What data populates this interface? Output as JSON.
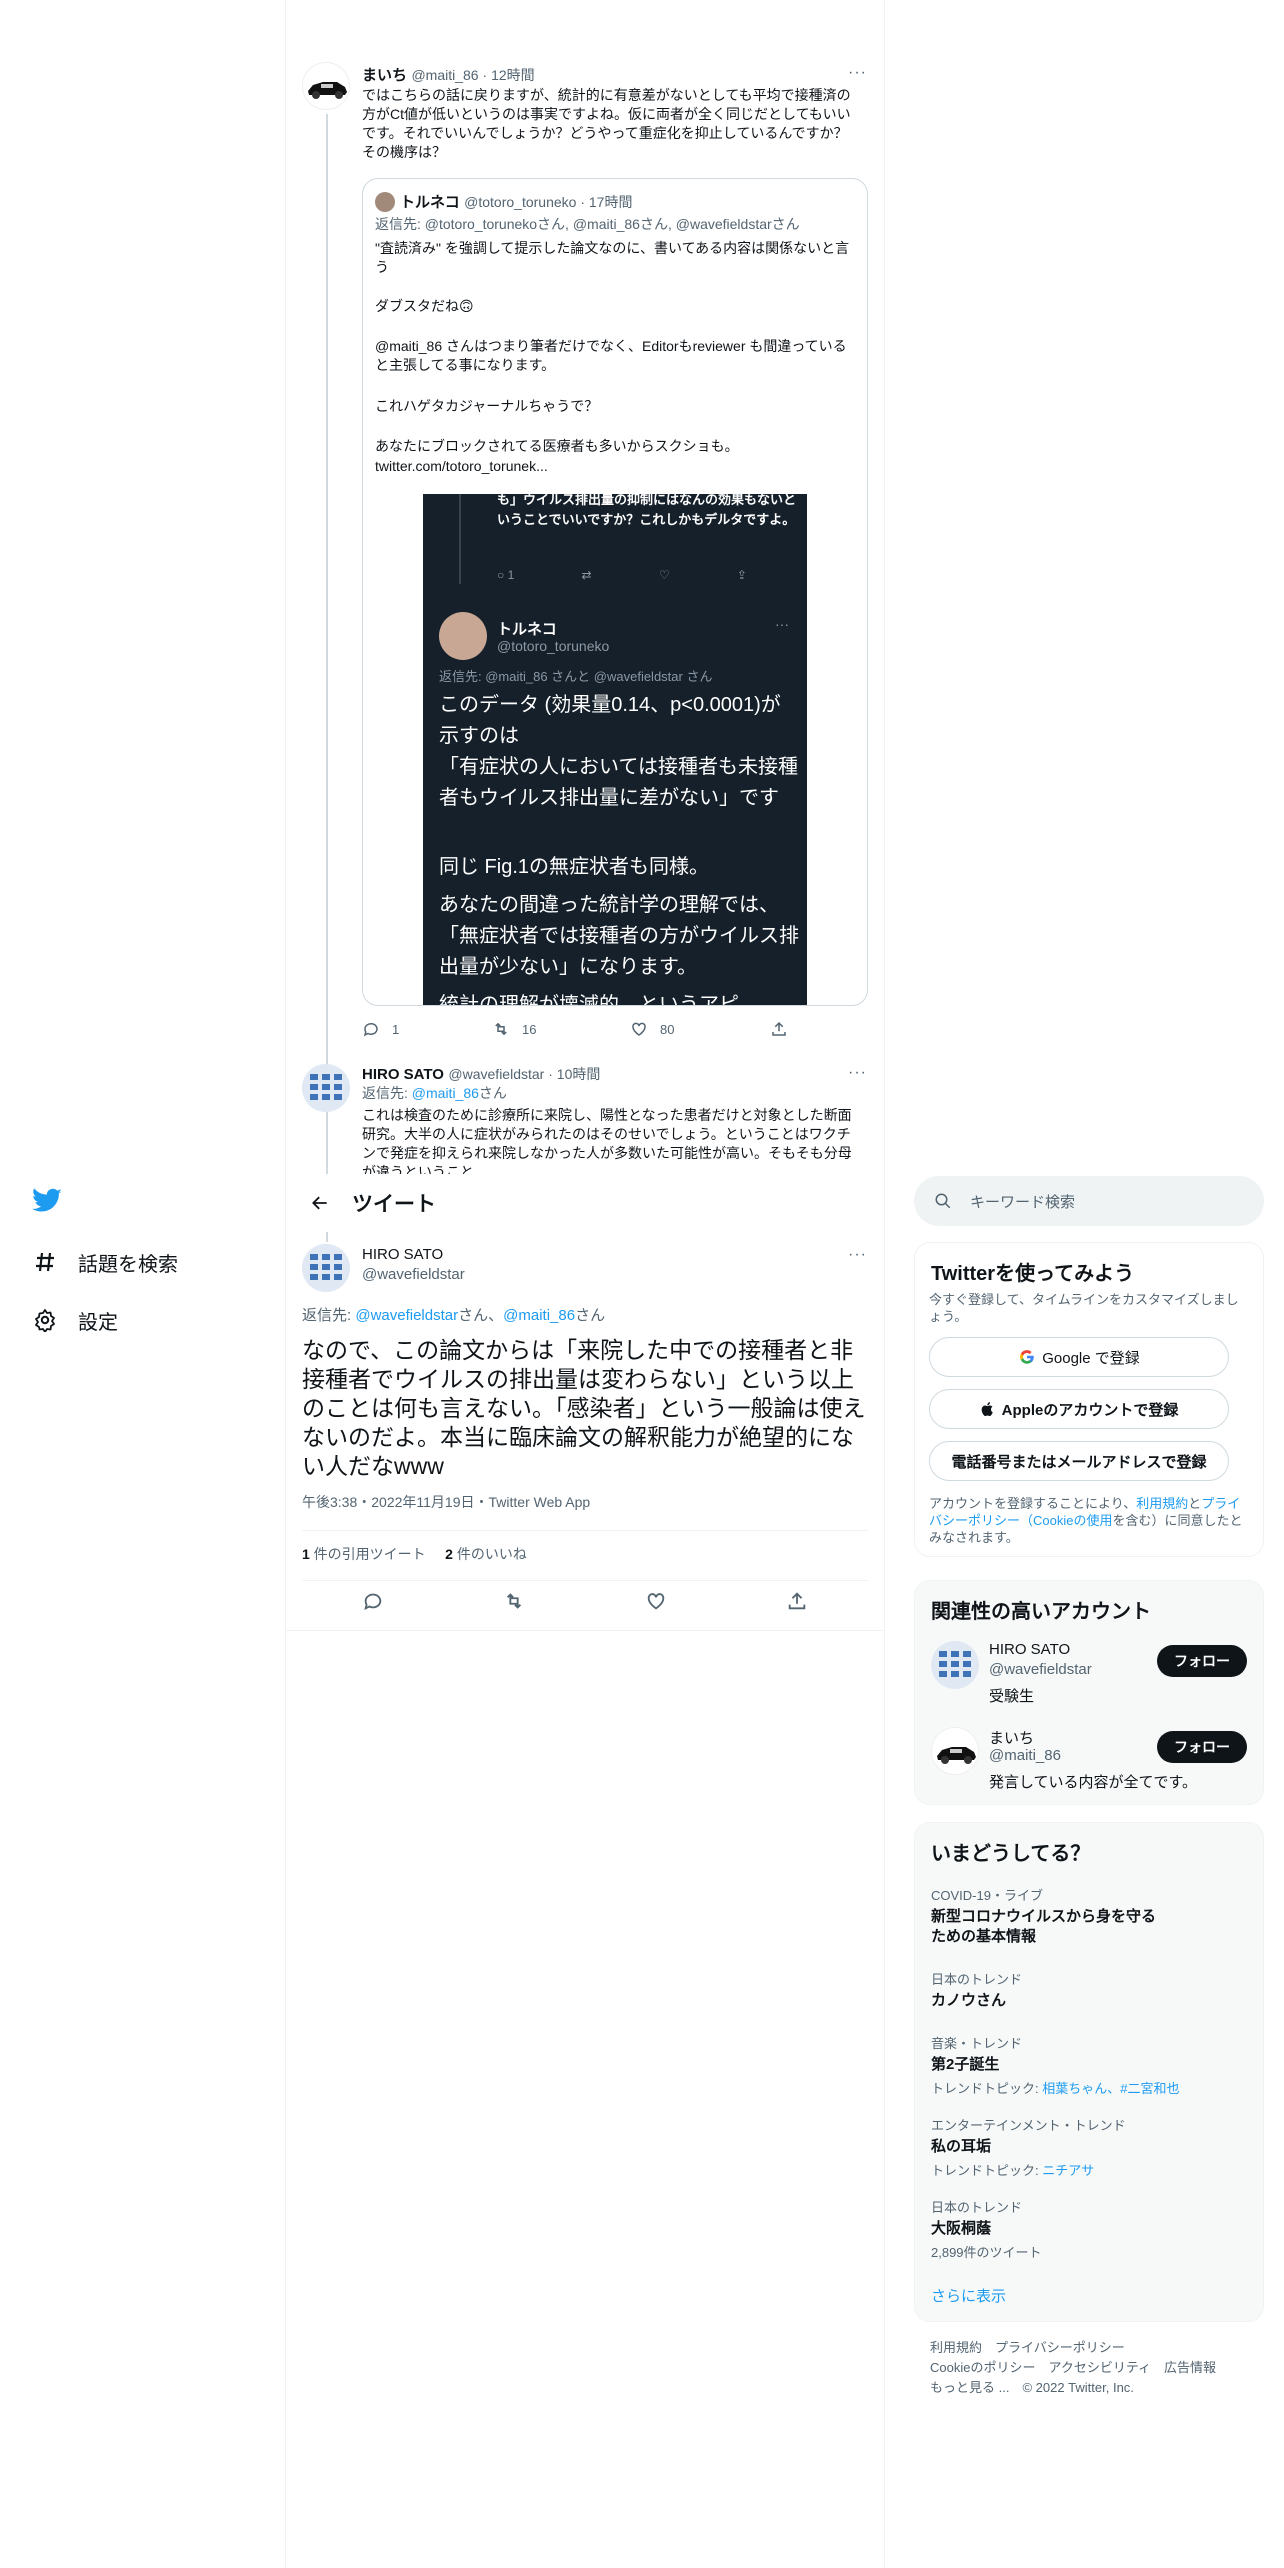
{
  "app": {
    "brand_color": "#1d9bf0"
  },
  "nav": {
    "logo_icon": "twitter-bird-icon",
    "explore": "話題を検索",
    "settings": "設定"
  },
  "header": {
    "title": "ツイート"
  },
  "thread": {
    "tweet1": {
      "name": "まいち",
      "handle": "@maiti_86",
      "time": "12時間",
      "text": "ではこちらの話に戻りますが、統計的に有意差がないとしても平均で接種済の方がCt値が低いというのは事実ですよね。仮に両者が全く同じだとしてもいいです。それでいいんでしょうか？どうやって重症化を抑止しているんですか？その機序は？",
      "quote": {
        "name": "トルネコ",
        "handle": "@totoro_toruneko",
        "time": "17時間",
        "reply_prefix": "返信先: ",
        "reply_to": "@totoro_torunekoさん, @maiti_86さん, @wavefieldstarさん",
        "p1": "\"査読済み\" を強調して提示した論文なのに、書いてある内容は関係ないと言う",
        "p2": "ダブスタだね🙃",
        "p3": "@maiti_86 さんはつまり筆者だけでなく、Editorもreviewer も間違っていると主張してる事になります。",
        "p4": "これハゲタカジャーナルちゃうで？",
        "p5": "あなたにブロックされてる医療者も多いからスクショも。",
        "p6": "twitter.com/totoro_torunek...",
        "image": {
          "top_text": "も」ウイルス排出量の抑制にはなんの効果もないということでいいですか？これしかもデルタですよ。",
          "top_reply_count": "1",
          "name": "トルネコ",
          "handle": "@totoro_toruneko",
          "reply_to": "返信先: @maiti_86 さんと @wavefieldstar さん",
          "p1": "このデータ (効果量0.14、p<0.0001)が示すのは",
          "p2": "「有症状の人においては接種者も未接種者もウイルス排出量に差がない」です",
          "p3": "同じ Fig.1の無症状者も同様。",
          "p4": "あなたの間違った統計学の理解では、「無症状者では接種者の方がウイルス排出量が少ない」になります。",
          "p5": "統計の理解が壊滅的、というアピ"
        }
      },
      "stats": {
        "replies": "1",
        "retweets": "16",
        "likes": "80"
      }
    },
    "tweet2": {
      "name": "HIRO SATO",
      "handle": "@wavefieldstar",
      "time": "10時間",
      "reply_prefix": "返信先: ",
      "reply_to": "@maiti_86",
      "reply_suffix": "さん",
      "text": "これは検査のために診療所に来院し、陽性となった患者だけと対象とした断面研究。大半の人に症状がみられたのはそのせいでしょう。ということはワクチンで発症を抑えられ来院しなかった人が多数いた可能性が高い。そもそも分母が違うということ"
    }
  },
  "main_tweet": {
    "name": "HIRO SATO",
    "handle": "@wavefieldstar",
    "reply_prefix": "返信先: ",
    "reply_to_1": "@wavefieldstar",
    "reply_mid": "さん、",
    "reply_to_2": "@maiti_86",
    "reply_suffix": "さん",
    "text": "なので、この論文からは「来院した中での接種者と非接種者でウイルスの排出量は変わらない」という以上のことは何も言えない。「感染者」という一般論は使えないのだよ。本当に臨床論文の解釈能力が絶望的にない人だなwww",
    "timestamp": "午後3:38・2022年11月19日・Twitter Web App",
    "quotes_count": "1",
    "quotes_label": " 件の引用ツイート",
    "likes_count": "2",
    "likes_label": " 件のいいね"
  },
  "right": {
    "search_placeholder": "キーワード検索",
    "signup": {
      "title": "Twitterを使ってみよう",
      "subtitle": "今すぐ登録して、タイムラインをカスタマイズしましょう。",
      "google": "Google で登録",
      "apple": "Appleのアカウントで登録",
      "phone": "電話番号またはメールアドレスで登録",
      "terms_1": "アカウントを登録することにより、",
      "terms_link1": "利用規約",
      "terms_2": "と",
      "terms_link2": "プライバシーポリシー（Cookieの使用",
      "terms_3": "を含む）に同意したとみなされます。"
    },
    "related": {
      "title": "関連性の高いアカウント",
      "accounts": [
        {
          "name": "HIRO SATO",
          "handle": "@wavefieldstar",
          "bio": "受験生",
          "follow": "フォロー"
        },
        {
          "name": "まいち",
          "handle": "@maiti_86",
          "bio": "発言している内容が全てです。",
          "follow": "フォロー"
        }
      ]
    },
    "trends": {
      "title": "いまどうしてる？",
      "items": [
        {
          "category": "COVID-19・ライブ",
          "name": "新型コロナウイルスから身を守るための基本情報"
        },
        {
          "category": "日本のトレンド",
          "name": "カノウさん"
        },
        {
          "category": "音楽・トレンド",
          "name": "第2子誕生",
          "sub_prefix": "トレンドトピック: ",
          "sub_links": "相葉ちゃん、#二宮和也"
        },
        {
          "category": "エンターテインメント・トレンド",
          "name": "私の耳垢",
          "sub_prefix": "トレンドトピック: ",
          "sub_links": "ニチアサ"
        },
        {
          "category": "日本のトレンド",
          "name": "大阪桐蔭",
          "sub": "2,899件のツイート"
        }
      ],
      "more": "さらに表示"
    },
    "footer": {
      "l1": "利用規約　プライバシーポリシー",
      "l2": "Cookieのポリシー　アクセシビリティ　広告情報",
      "l3": "もっと見る ...　© 2022 Twitter, Inc."
    }
  }
}
